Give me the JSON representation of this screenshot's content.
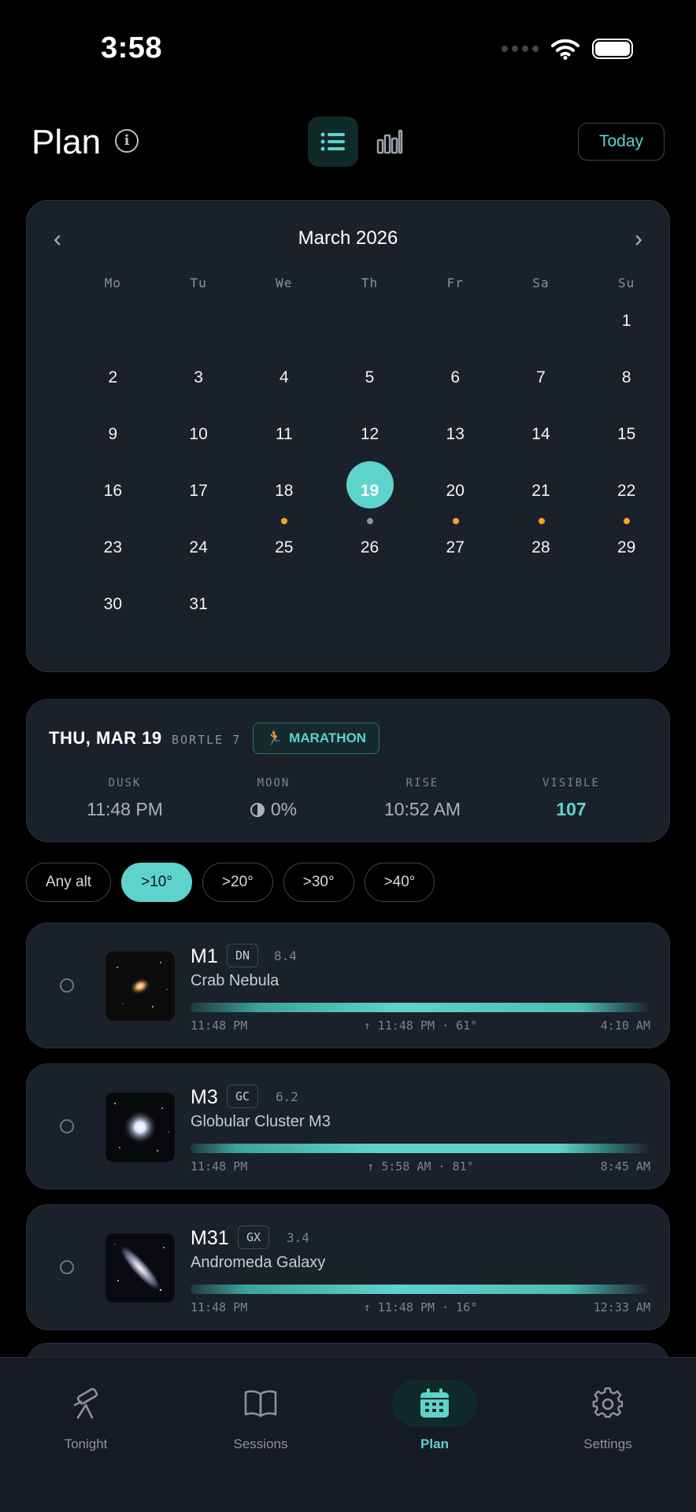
{
  "status": {
    "time": "3:58"
  },
  "header": {
    "title": "Plan",
    "today_label": "Today"
  },
  "calendar": {
    "month_label": "March 2026",
    "prev_label": "‹",
    "next_label": "›",
    "weekdays": [
      "Mo",
      "Tu",
      "We",
      "Th",
      "Fr",
      "Sa",
      "Su"
    ],
    "weeks": [
      [
        "",
        "",
        "",
        "",
        "",
        "",
        "1"
      ],
      [
        "2",
        "3",
        "4",
        "5",
        "6",
        "7",
        "8"
      ],
      [
        "9",
        "10",
        "11",
        "12",
        "13",
        "14",
        "15"
      ],
      [
        "16",
        "17",
        "18",
        "19",
        "20",
        "21",
        "22"
      ],
      [
        "23",
        "24",
        "25",
        "26",
        "27",
        "28",
        "29"
      ],
      [
        "30",
        "31",
        "",
        "",
        "",
        "",
        ""
      ]
    ],
    "selected_day": "19",
    "colors": {
      "selected": "#5ed3cc",
      "dot_orange": "#f4a62a",
      "dot_gray": "#8a929d"
    }
  },
  "night": {
    "date": "THU, MAR 19",
    "bortle": "BORTLE 7",
    "badge": "MARATHON",
    "stats": [
      {
        "label": "DUSK",
        "value": "11:48 PM"
      },
      {
        "label": "MOON",
        "value": "0%"
      },
      {
        "label": "RISE",
        "value": "10:52 AM"
      },
      {
        "label": "VISIBLE",
        "value": "107"
      }
    ]
  },
  "filters": [
    "Any alt",
    ">10°",
    ">20°",
    ">30°",
    ">40°"
  ],
  "active_filter": ">10°",
  "objects": [
    {
      "name": "M1",
      "type": "DN",
      "mag": "8.4",
      "full_name": "Crab Nebula",
      "start": "11:48 PM",
      "peak": "↑ 11:48 PM · 61°",
      "end": "4:10 AM"
    },
    {
      "name": "M3",
      "type": "GC",
      "mag": "6.2",
      "full_name": "Globular Cluster M3",
      "start": "11:48 PM",
      "peak": "↑ 5:58 AM · 81°",
      "end": "8:45 AM"
    },
    {
      "name": "M31",
      "type": "GX",
      "mag": "3.4",
      "full_name": "Andromeda Galaxy",
      "start": "11:48 PM",
      "peak": "↑ 11:48 PM · 16°",
      "end": "12:33 AM"
    }
  ],
  "tabs": [
    {
      "label": "Tonight",
      "icon": "telescope-icon"
    },
    {
      "label": "Sessions",
      "icon": "book-icon"
    },
    {
      "label": "Plan",
      "icon": "calendar-icon"
    },
    {
      "label": "Settings",
      "icon": "gear-icon"
    }
  ],
  "accent_color": "#5ed3cc"
}
